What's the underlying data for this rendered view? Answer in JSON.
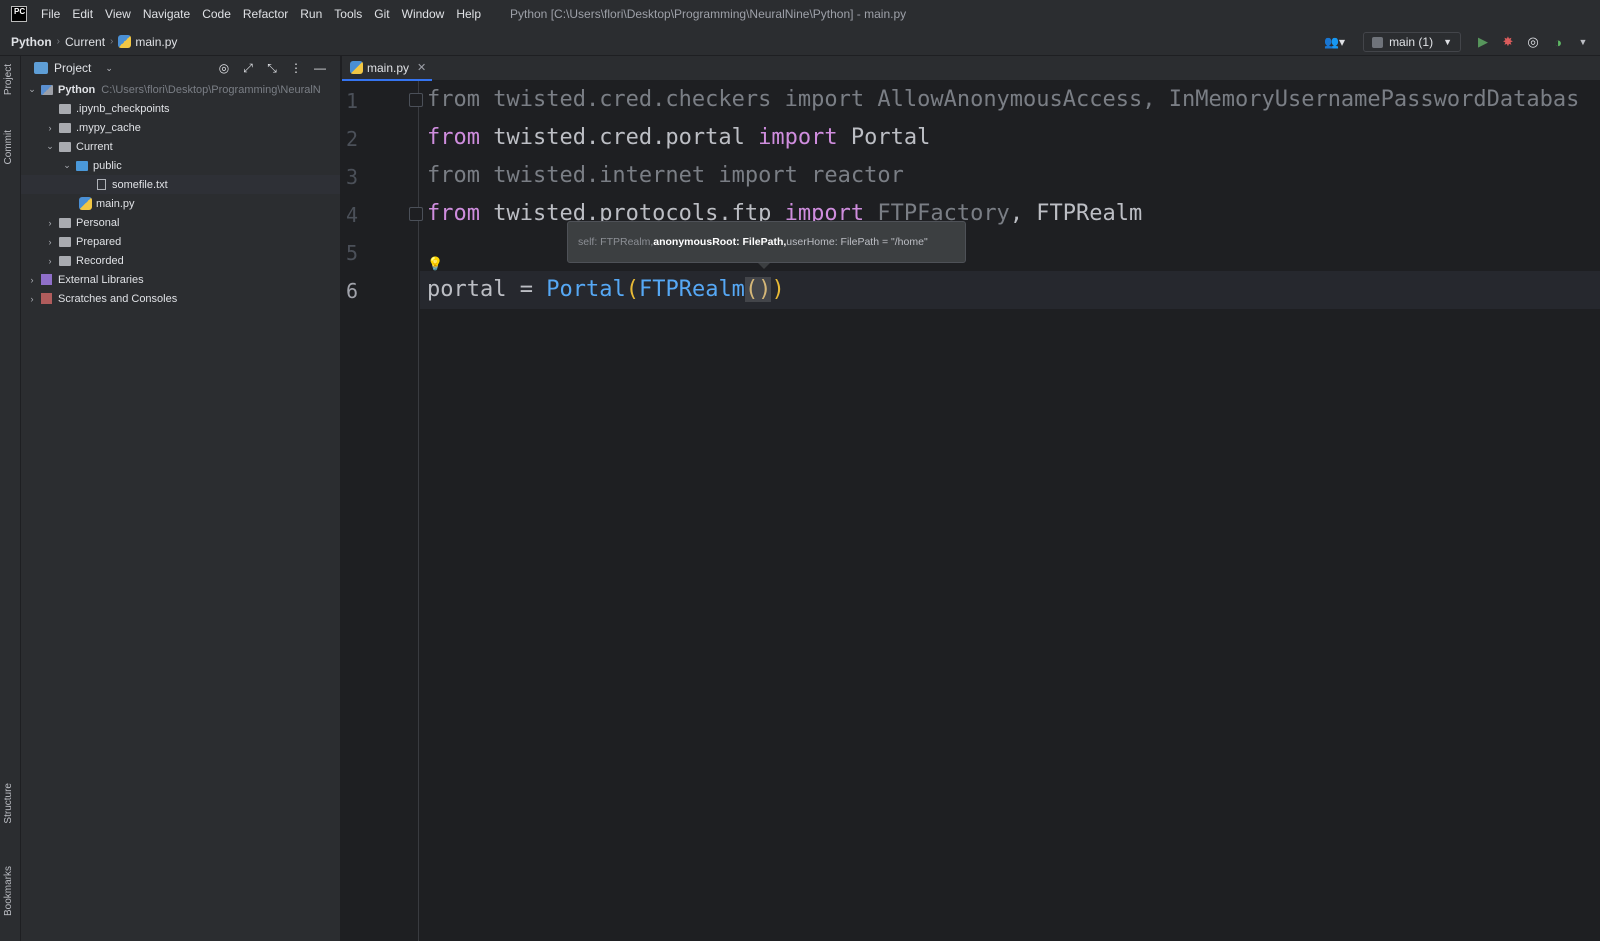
{
  "menubar": {
    "logo_text": "PC",
    "items": [
      "File",
      "Edit",
      "View",
      "Navigate",
      "Code",
      "Refactor",
      "Run",
      "Tools",
      "Git",
      "Window",
      "Help"
    ],
    "window_title": "Python [C:\\Users\\flori\\Desktop\\Programming\\NeuralNine\\Python] - main.py"
  },
  "navbar": {
    "breadcrumbs": [
      "Python",
      "Current",
      "main.py"
    ],
    "run_config": "main (1)"
  },
  "leftstrip": {
    "tabs": [
      "Project",
      "Commit",
      "Structure",
      "Bookmarks"
    ]
  },
  "project_panel": {
    "title": "Project",
    "tree": [
      {
        "label": "Python",
        "hint": "C:\\Users\\flori\\Desktop\\Programming\\NeuralN"
      },
      {
        "label": ".ipynb_checkpoints"
      },
      {
        "label": ".mypy_cache"
      },
      {
        "label": "Current"
      },
      {
        "label": "public"
      },
      {
        "label": "somefile.txt"
      },
      {
        "label": "main.py"
      },
      {
        "label": "Personal"
      },
      {
        "label": "Prepared"
      },
      {
        "label": "Recorded"
      },
      {
        "label": "External Libraries"
      },
      {
        "label": "Scratches and Consoles"
      }
    ]
  },
  "editor": {
    "tab_label": "main.py",
    "line_numbers": [
      "1",
      "2",
      "3",
      "4",
      "5",
      "6"
    ],
    "lines": {
      "l1": {
        "kw": "from",
        "mod": " twisted.cred.checkers ",
        "kw2": "import",
        "rest": " AllowAnonymousAccess, InMemoryUsernamePasswordDatabas"
      },
      "l2": {
        "kw": "from",
        "mod": " twisted.cred.portal ",
        "kw2": "import",
        "rest": " Portal"
      },
      "l3": {
        "kw": "from",
        "mod": " twisted.internet ",
        "kw2": "import",
        "rest": " reactor"
      },
      "l4": {
        "kw": "from",
        "mod": " twisted.protocols.ftp ",
        "kw2": "import",
        "rest1": " FTPFactory",
        "rest2": ", FTPRealm"
      },
      "l6": {
        "var": "portal",
        "op": " = ",
        "fn1": "Portal",
        "p1": "(",
        "fn2": "FTPRealm",
        "p2": "()",
        "p3": ")"
      }
    },
    "param_popup": {
      "dim": "self: FTPRealm, ",
      "bold": "anonymousRoot: FilePath,",
      "rest": " userHome: FilePath = \"/home\""
    }
  }
}
